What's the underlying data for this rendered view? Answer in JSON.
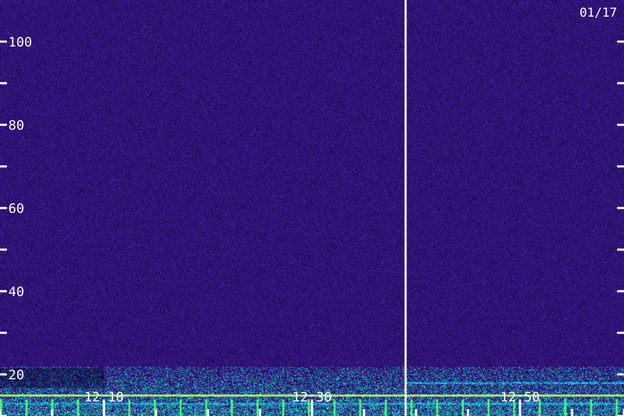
{
  "date_label": "01/17",
  "colors": {
    "background": "#24106e",
    "marker_line": "#ffffff",
    "text": "#ffffff",
    "low_band_green": "#3cff66",
    "low_band_cyan": "#20c8ff",
    "low_band_yellow": "#e6ff44"
  },
  "chart_data": {
    "type": "heatmap",
    "title": "",
    "xlabel": "",
    "ylabel": "",
    "ylim": [
      10,
      110
    ],
    "y_ticks": [
      {
        "value": 100,
        "label": "100"
      },
      {
        "value": 80,
        "label": "80"
      },
      {
        "value": 60,
        "label": "60"
      },
      {
        "value": 40,
        "label": "40"
      },
      {
        "value": 20,
        "label": "20"
      }
    ],
    "y_minor_ticks": [
      90,
      70,
      50,
      30,
      10
    ],
    "x_range_minutes": [
      "12:00",
      "13:00"
    ],
    "x_ticks": [
      {
        "value": "12:10",
        "label": "12:10"
      },
      {
        "value": "12:30",
        "label": "12:30"
      },
      {
        "value": "12:50",
        "label": "12:50"
      }
    ],
    "x_minor_ticks": [
      "12:00",
      "12:05",
      "12:15",
      "12:20",
      "12:25",
      "12:35",
      "12:40",
      "12:45",
      "12:55",
      "13:00"
    ],
    "marker_time": "12:39",
    "low_frequency_bands": [
      {
        "value": 15,
        "intensity": "high"
      },
      {
        "value": 13,
        "intensity": "medium"
      },
      {
        "value": 18,
        "intensity": "medium",
        "start_time": "12:39"
      }
    ]
  }
}
